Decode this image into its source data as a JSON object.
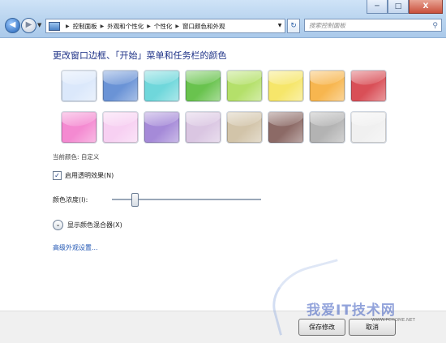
{
  "window": {
    "min_label": "─",
    "max_label": "□",
    "close_label": "X"
  },
  "nav": {
    "back": "◀",
    "forward": "▶",
    "drop": "▼"
  },
  "breadcrumb": [
    "控制面板",
    "外观和个性化",
    "个性化",
    "窗口颜色和外观"
  ],
  "search": {
    "placeholder": "搜索控制面板"
  },
  "heading": "更改窗口边框、「开始」菜单和任务栏的颜色",
  "swatches": {
    "row1": [
      "#dbe8fb",
      "#6a93d6",
      "#6fd7db",
      "#69c34e",
      "#b4e06a",
      "#f6e66a",
      "#f7b64f",
      "#d94f57"
    ],
    "row2": [
      "#f48ad1",
      "#f7d0f2",
      "#a58ad8",
      "#dac6e2",
      "#d2c4a9",
      "#8c6a66",
      "#b3b3b3",
      "#f0f0f0"
    ]
  },
  "current_color": "当前颜色: 自定义",
  "transparency": {
    "label": "启用透明效果(N)",
    "checked": true,
    "mark": "✓"
  },
  "intensity": {
    "label": "颜色浓度(I):",
    "level": 0.15
  },
  "mixer": {
    "label": "显示颜色混合器(X)",
    "icon": "⌄"
  },
  "advanced_link": "高级外观设置...",
  "footer": {
    "save": "保存修改",
    "cancel": "取消"
  },
  "watermark": {
    "main": "我爱IT技术网",
    "sub": "WWW.PCHOME.NET"
  }
}
